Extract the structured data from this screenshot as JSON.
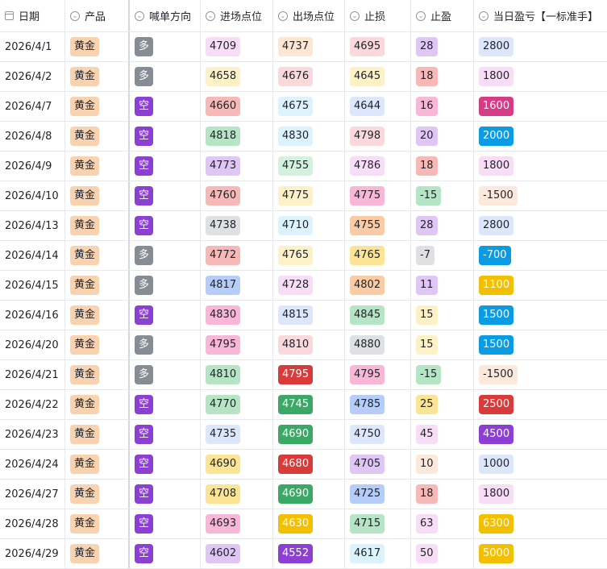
{
  "headers": [
    {
      "label": "日期",
      "icon": "calendar-icon"
    },
    {
      "label": "产品",
      "icon": "option-icon"
    },
    {
      "label": "喊单方向",
      "icon": "option-icon"
    },
    {
      "label": "进场点位",
      "icon": "option-icon"
    },
    {
      "label": "出场点位",
      "icon": "option-icon"
    },
    {
      "label": "止损",
      "icon": "option-icon"
    },
    {
      "label": "止盈",
      "icon": "option-icon"
    },
    {
      "label": "当日盈亏【一标准手】",
      "icon": "option-icon"
    }
  ],
  "rows": [
    {
      "date": "2026/4/1",
      "product": {
        "text": "黄金",
        "bg": "#f9d3b0",
        "fg": "#1f2329"
      },
      "direction": {
        "text": "多",
        "bg": "#868c94",
        "fg": "#ffffff"
      },
      "entry": {
        "text": "4709",
        "bg": "#f8ddf7",
        "fg": "#1f2329"
      },
      "exit": {
        "text": "4737",
        "bg": "#fde6d2",
        "fg": "#1f2329"
      },
      "stop_loss": {
        "text": "4695",
        "bg": "#fad9dc",
        "fg": "#1f2329"
      },
      "take_profit": {
        "text": "28",
        "bg": "#e0c6f5",
        "fg": "#1f2329"
      },
      "pnl": {
        "text": "2800",
        "bg": "#dde7fb",
        "fg": "#1f2329"
      }
    },
    {
      "date": "2026/4/2",
      "product": {
        "text": "黄金",
        "bg": "#f9d3b0",
        "fg": "#1f2329"
      },
      "direction": {
        "text": "多",
        "bg": "#868c94",
        "fg": "#ffffff"
      },
      "entry": {
        "text": "4658",
        "bg": "#fdf2c7",
        "fg": "#1f2329"
      },
      "exit": {
        "text": "4676",
        "bg": "#fad9dc",
        "fg": "#1f2329"
      },
      "stop_loss": {
        "text": "4645",
        "bg": "#fdf2c7",
        "fg": "#1f2329"
      },
      "take_profit": {
        "text": "18",
        "bg": "#f7b9b8",
        "fg": "#1f2329"
      },
      "pnl": {
        "text": "1800",
        "bg": "#f8ddf7",
        "fg": "#1f2329"
      }
    },
    {
      "date": "2026/4/7",
      "product": {
        "text": "黄金",
        "bg": "#f9d3b0",
        "fg": "#1f2329"
      },
      "direction": {
        "text": "空",
        "bg": "#8c3fd3",
        "fg": "#ffffff"
      },
      "entry": {
        "text": "4660",
        "bg": "#f7b9b8",
        "fg": "#1f2329"
      },
      "exit": {
        "text": "4675",
        "bg": "#dcf2fc",
        "fg": "#1f2329"
      },
      "stop_loss": {
        "text": "4644",
        "bg": "#dde7fb",
        "fg": "#1f2329"
      },
      "take_profit": {
        "text": "16",
        "bg": "#f9b7d7",
        "fg": "#1f2329"
      },
      "pnl": {
        "text": "1600",
        "bg": "#d53c86",
        "fg": "#ffffff"
      }
    },
    {
      "date": "2026/4/8",
      "product": {
        "text": "黄金",
        "bg": "#f9d3b0",
        "fg": "#1f2329"
      },
      "direction": {
        "text": "空",
        "bg": "#8c3fd3",
        "fg": "#ffffff"
      },
      "entry": {
        "text": "4818",
        "bg": "#b6e5c5",
        "fg": "#1f2329"
      },
      "exit": {
        "text": "4830",
        "bg": "#dcf2fc",
        "fg": "#1f2329"
      },
      "stop_loss": {
        "text": "4798",
        "bg": "#fad9dc",
        "fg": "#1f2329"
      },
      "take_profit": {
        "text": "20",
        "bg": "#e0c6f5",
        "fg": "#1f2329"
      },
      "pnl": {
        "text": "2000",
        "bg": "#0b9be3",
        "fg": "#ffffff"
      }
    },
    {
      "date": "2026/4/9",
      "product": {
        "text": "黄金",
        "bg": "#f9d3b0",
        "fg": "#1f2329"
      },
      "direction": {
        "text": "空",
        "bg": "#8c3fd3",
        "fg": "#ffffff"
      },
      "entry": {
        "text": "4773",
        "bg": "#e0c6f5",
        "fg": "#1f2329"
      },
      "exit": {
        "text": "4755",
        "bg": "#d4f1de",
        "fg": "#1f2329"
      },
      "stop_loss": {
        "text": "4786",
        "bg": "#f8ddf7",
        "fg": "#1f2329"
      },
      "take_profit": {
        "text": "18",
        "bg": "#f7b9b8",
        "fg": "#1f2329"
      },
      "pnl": {
        "text": "1800",
        "bg": "#f8ddf7",
        "fg": "#1f2329"
      }
    },
    {
      "date": "2026/4/10",
      "product": {
        "text": "黄金",
        "bg": "#f9d3b0",
        "fg": "#1f2329"
      },
      "direction": {
        "text": "空",
        "bg": "#8c3fd3",
        "fg": "#ffffff"
      },
      "entry": {
        "text": "4760",
        "bg": "#f7b9b8",
        "fg": "#1f2329"
      },
      "exit": {
        "text": "4775",
        "bg": "#fdf2c7",
        "fg": "#1f2329"
      },
      "stop_loss": {
        "text": "4775",
        "bg": "#f9b7d7",
        "fg": "#1f2329"
      },
      "take_profit": {
        "text": "-15",
        "bg": "#b6e5c5",
        "fg": "#1f2329"
      },
      "pnl": {
        "text": "-1500",
        "bg": "#fde9dc",
        "fg": "#1f2329"
      }
    },
    {
      "date": "2026/4/13",
      "product": {
        "text": "黄金",
        "bg": "#f9d3b0",
        "fg": "#1f2329"
      },
      "direction": {
        "text": "空",
        "bg": "#8c3fd3",
        "fg": "#ffffff"
      },
      "entry": {
        "text": "4738",
        "bg": "#dee0e3",
        "fg": "#1f2329"
      },
      "exit": {
        "text": "4710",
        "bg": "#dcf2fc",
        "fg": "#1f2329"
      },
      "stop_loss": {
        "text": "4755",
        "bg": "#f9cca6",
        "fg": "#1f2329"
      },
      "take_profit": {
        "text": "28",
        "bg": "#e0c6f5",
        "fg": "#1f2329"
      },
      "pnl": {
        "text": "2800",
        "bg": "#dde7fb",
        "fg": "#1f2329"
      }
    },
    {
      "date": "2026/4/14",
      "product": {
        "text": "黄金",
        "bg": "#f9d3b0",
        "fg": "#1f2329"
      },
      "direction": {
        "text": "多",
        "bg": "#868c94",
        "fg": "#ffffff"
      },
      "entry": {
        "text": "4772",
        "bg": "#f7b9b8",
        "fg": "#1f2329"
      },
      "exit": {
        "text": "4765",
        "bg": "#fdf2c7",
        "fg": "#1f2329"
      },
      "stop_loss": {
        "text": "4765",
        "bg": "#fbe493",
        "fg": "#1f2329"
      },
      "take_profit": {
        "text": "-7",
        "bg": "#dee0e3",
        "fg": "#1f2329"
      },
      "pnl": {
        "text": "-700",
        "bg": "#0b9be3",
        "fg": "#ffffff"
      }
    },
    {
      "date": "2026/4/15",
      "product": {
        "text": "黄金",
        "bg": "#f9d3b0",
        "fg": "#1f2329"
      },
      "direction": {
        "text": "多",
        "bg": "#868c94",
        "fg": "#ffffff"
      },
      "entry": {
        "text": "4817",
        "bg": "#b5cdf8",
        "fg": "#1f2329"
      },
      "exit": {
        "text": "4728",
        "bg": "#f8ddf7",
        "fg": "#1f2329"
      },
      "stop_loss": {
        "text": "4802",
        "bg": "#f9cca6",
        "fg": "#1f2329"
      },
      "take_profit": {
        "text": "11",
        "bg": "#e0c6f5",
        "fg": "#1f2329"
      },
      "pnl": {
        "text": "1100",
        "bg": "#f2c000",
        "fg": "#ffffff"
      }
    },
    {
      "date": "2026/4/16",
      "product": {
        "text": "黄金",
        "bg": "#f9d3b0",
        "fg": "#1f2329"
      },
      "direction": {
        "text": "空",
        "bg": "#8c3fd3",
        "fg": "#ffffff"
      },
      "entry": {
        "text": "4830",
        "bg": "#f9b7d7",
        "fg": "#1f2329"
      },
      "exit": {
        "text": "4815",
        "bg": "#dde7fb",
        "fg": "#1f2329"
      },
      "stop_loss": {
        "text": "4845",
        "bg": "#b6e5c5",
        "fg": "#1f2329"
      },
      "take_profit": {
        "text": "15",
        "bg": "#fdf2c7",
        "fg": "#1f2329"
      },
      "pnl": {
        "text": "1500",
        "bg": "#0b9be3",
        "fg": "#ffffff"
      }
    },
    {
      "date": "2026/4/20",
      "product": {
        "text": "黄金",
        "bg": "#f9d3b0",
        "fg": "#1f2329"
      },
      "direction": {
        "text": "多",
        "bg": "#868c94",
        "fg": "#ffffff"
      },
      "entry": {
        "text": "4795",
        "bg": "#f9b7d7",
        "fg": "#1f2329"
      },
      "exit": {
        "text": "4810",
        "bg": "#fad9dc",
        "fg": "#1f2329"
      },
      "stop_loss": {
        "text": "4880",
        "bg": "#dee0e3",
        "fg": "#1f2329"
      },
      "take_profit": {
        "text": "15",
        "bg": "#fdf2c7",
        "fg": "#1f2329"
      },
      "pnl": {
        "text": "1500",
        "bg": "#0b9be3",
        "fg": "#ffffff"
      }
    },
    {
      "date": "2026/4/21",
      "product": {
        "text": "黄金",
        "bg": "#f9d3b0",
        "fg": "#1f2329"
      },
      "direction": {
        "text": "多",
        "bg": "#868c94",
        "fg": "#ffffff"
      },
      "entry": {
        "text": "4810",
        "bg": "#b6e5c5",
        "fg": "#1f2329"
      },
      "exit": {
        "text": "4795",
        "bg": "#d93b3b",
        "fg": "#ffffff"
      },
      "stop_loss": {
        "text": "4795",
        "bg": "#f9b7d7",
        "fg": "#1f2329"
      },
      "take_profit": {
        "text": "-15",
        "bg": "#b6e5c5",
        "fg": "#1f2329"
      },
      "pnl": {
        "text": "-1500",
        "bg": "#fde9dc",
        "fg": "#1f2329"
      }
    },
    {
      "date": "2026/4/22",
      "product": {
        "text": "黄金",
        "bg": "#f9d3b0",
        "fg": "#1f2329"
      },
      "direction": {
        "text": "空",
        "bg": "#8c3fd3",
        "fg": "#ffffff"
      },
      "entry": {
        "text": "4770",
        "bg": "#b6e5c5",
        "fg": "#1f2329"
      },
      "exit": {
        "text": "4745",
        "bg": "#3ba866",
        "fg": "#ffffff"
      },
      "stop_loss": {
        "text": "4785",
        "bg": "#b5cdf8",
        "fg": "#1f2329"
      },
      "take_profit": {
        "text": "25",
        "bg": "#fbe493",
        "fg": "#1f2329"
      },
      "pnl": {
        "text": "2500",
        "bg": "#d93b3b",
        "fg": "#ffffff"
      }
    },
    {
      "date": "2026/4/23",
      "product": {
        "text": "黄金",
        "bg": "#f9d3b0",
        "fg": "#1f2329"
      },
      "direction": {
        "text": "空",
        "bg": "#8c3fd3",
        "fg": "#ffffff"
      },
      "entry": {
        "text": "4735",
        "bg": "#dde7fb",
        "fg": "#1f2329"
      },
      "exit": {
        "text": "4690",
        "bg": "#3ba866",
        "fg": "#ffffff"
      },
      "stop_loss": {
        "text": "4750",
        "bg": "#dde7fb",
        "fg": "#1f2329"
      },
      "take_profit": {
        "text": "45",
        "bg": "#f8ddf7",
        "fg": "#1f2329"
      },
      "pnl": {
        "text": "4500",
        "bg": "#8c3fd3",
        "fg": "#ffffff"
      }
    },
    {
      "date": "2026/4/24",
      "product": {
        "text": "黄金",
        "bg": "#f9d3b0",
        "fg": "#1f2329"
      },
      "direction": {
        "text": "空",
        "bg": "#8c3fd3",
        "fg": "#ffffff"
      },
      "entry": {
        "text": "4690",
        "bg": "#fbe493",
        "fg": "#1f2329"
      },
      "exit": {
        "text": "4680",
        "bg": "#d93b3b",
        "fg": "#ffffff"
      },
      "stop_loss": {
        "text": "4705",
        "bg": "#e0c6f5",
        "fg": "#1f2329"
      },
      "take_profit": {
        "text": "10",
        "bg": "#fde9dc",
        "fg": "#1f2329"
      },
      "pnl": {
        "text": "1000",
        "bg": "#dde7fb",
        "fg": "#1f2329"
      }
    },
    {
      "date": "2026/4/27",
      "product": {
        "text": "黄金",
        "bg": "#f9d3b0",
        "fg": "#1f2329"
      },
      "direction": {
        "text": "空",
        "bg": "#8c3fd3",
        "fg": "#ffffff"
      },
      "entry": {
        "text": "4708",
        "bg": "#fbe493",
        "fg": "#1f2329"
      },
      "exit": {
        "text": "4690",
        "bg": "#3ba866",
        "fg": "#ffffff"
      },
      "stop_loss": {
        "text": "4725",
        "bg": "#b5cdf8",
        "fg": "#1f2329"
      },
      "take_profit": {
        "text": "18",
        "bg": "#f7b9b8",
        "fg": "#1f2329"
      },
      "pnl": {
        "text": "1800",
        "bg": "#f8ddf7",
        "fg": "#1f2329"
      }
    },
    {
      "date": "2026/4/28",
      "product": {
        "text": "黄金",
        "bg": "#f9d3b0",
        "fg": "#1f2329"
      },
      "direction": {
        "text": "空",
        "bg": "#8c3fd3",
        "fg": "#ffffff"
      },
      "entry": {
        "text": "4693",
        "bg": "#f9b7d7",
        "fg": "#1f2329"
      },
      "exit": {
        "text": "4630",
        "bg": "#f2c000",
        "fg": "#ffffff"
      },
      "stop_loss": {
        "text": "4715",
        "bg": "#b6e5c5",
        "fg": "#1f2329"
      },
      "take_profit": {
        "text": "63",
        "bg": "#f8ddf7",
        "fg": "#1f2329"
      },
      "pnl": {
        "text": "6300",
        "bg": "#f2c000",
        "fg": "#ffffff"
      }
    },
    {
      "date": "2026/4/29",
      "product": {
        "text": "黄金",
        "bg": "#f9d3b0",
        "fg": "#1f2329"
      },
      "direction": {
        "text": "空",
        "bg": "#8c3fd3",
        "fg": "#ffffff"
      },
      "entry": {
        "text": "4602",
        "bg": "#e0c6f5",
        "fg": "#1f2329"
      },
      "exit": {
        "text": "4552",
        "bg": "#8c3fd3",
        "fg": "#ffffff"
      },
      "stop_loss": {
        "text": "4617",
        "bg": "#dcf2fc",
        "fg": "#1f2329"
      },
      "take_profit": {
        "text": "50",
        "bg": "#f8ddf7",
        "fg": "#1f2329"
      },
      "pnl": {
        "text": "5000",
        "bg": "#f2c000",
        "fg": "#ffffff"
      }
    }
  ]
}
